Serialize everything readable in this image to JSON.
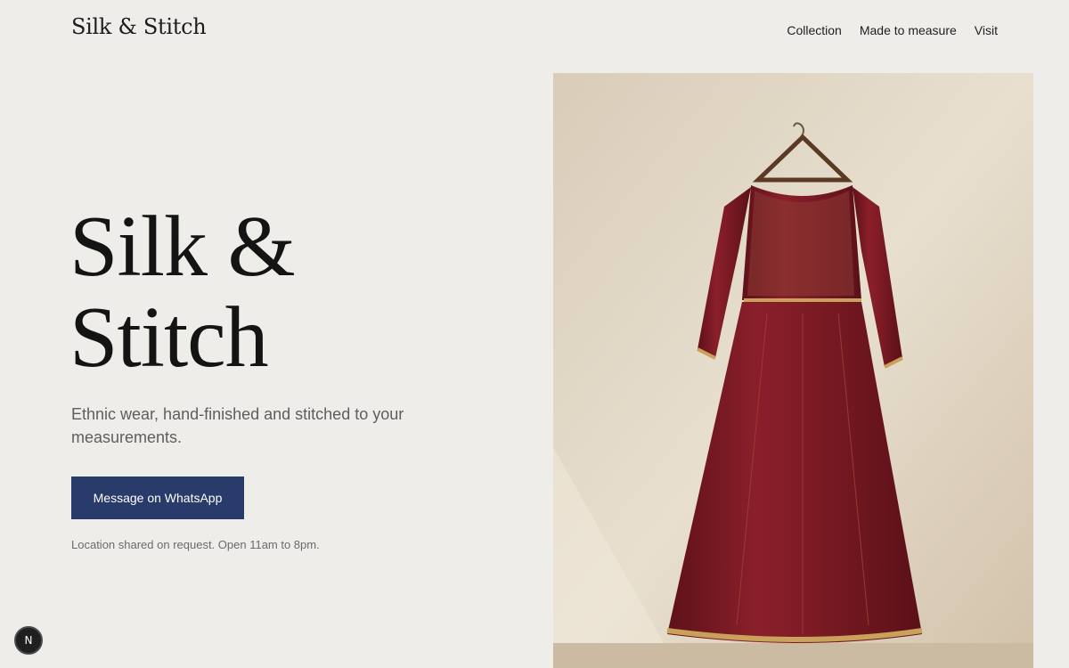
{
  "header": {
    "logo": "Silk & Stitch",
    "nav": [
      "Collection",
      "Made to measure",
      "Visit"
    ]
  },
  "hero": {
    "title_line1": "Silk &",
    "title_line2": "Stitch",
    "subtitle": "Ethnic wear, hand-finished and stitched to your measurements.",
    "cta_label": "Message on WhatsApp",
    "note": "Location shared on request. Open 11am to 8pm."
  },
  "badge": {
    "label": "N"
  },
  "colors": {
    "background": "#efede9",
    "cta": "#283b6b",
    "dress": "#7a1a22"
  }
}
